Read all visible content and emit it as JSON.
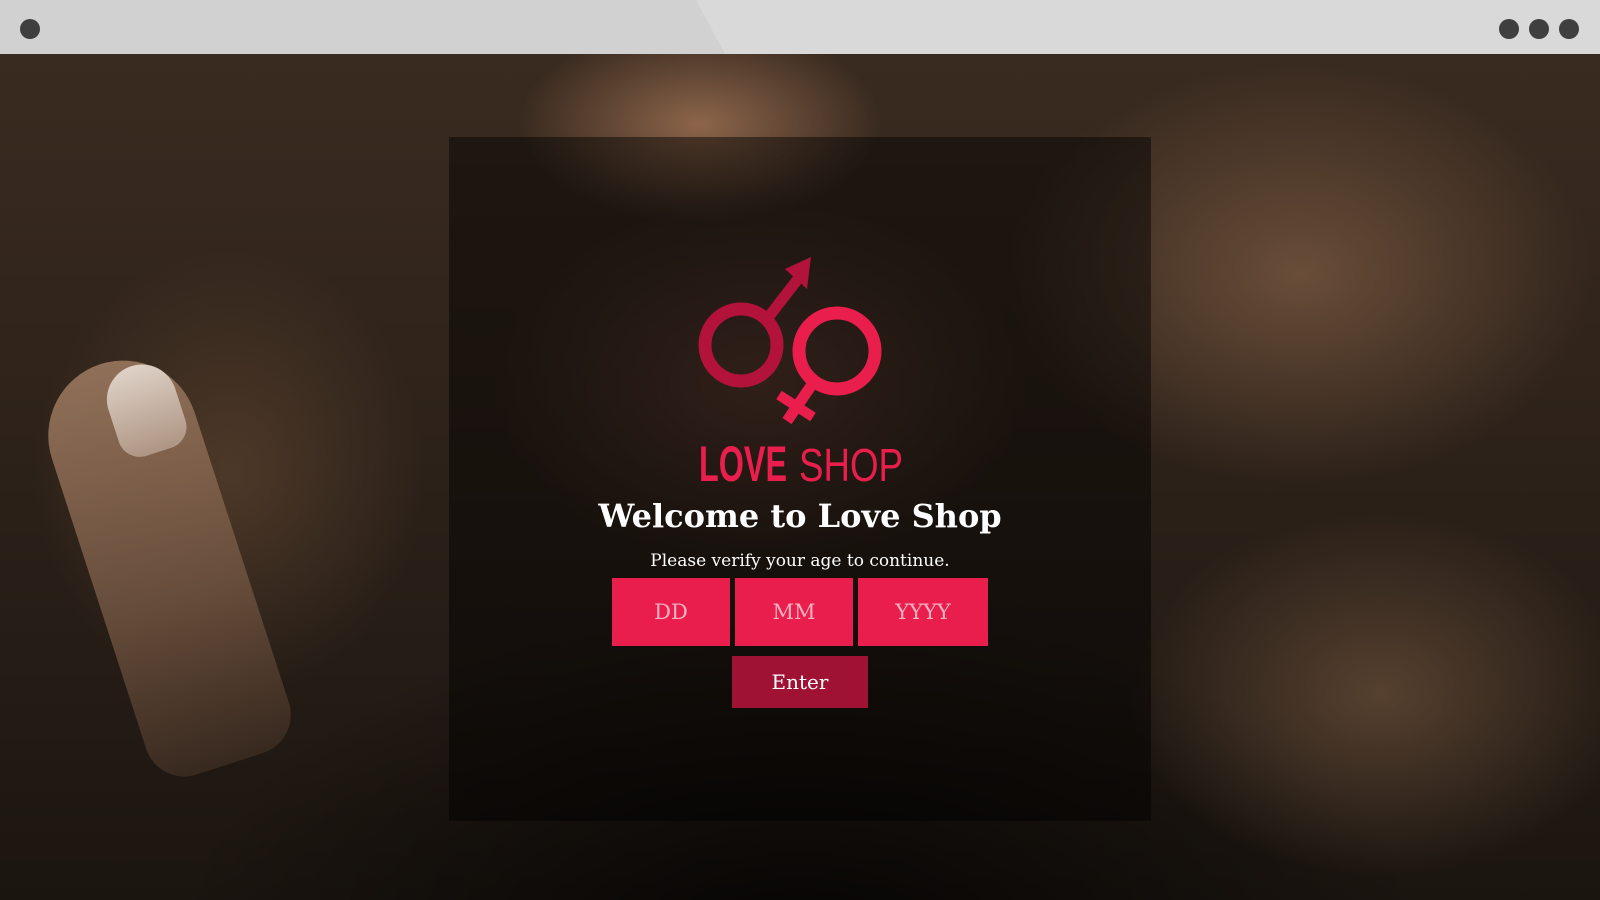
{
  "browser": {
    "window_controls": [
      "circle",
      "circle",
      "circle"
    ]
  },
  "background": {
    "description_icon": "photo-background"
  },
  "modal": {
    "logo": {
      "text_love": "LOVE",
      "text_shop": "SHOP",
      "primary_color": "#e91e4c",
      "dark_color": "#b3123a"
    },
    "title": "Welcome to Love Shop",
    "subtitle": "Please verify your age to continue.",
    "fields": {
      "day_placeholder": "DD",
      "month_placeholder": "MM",
      "year_placeholder": "YYYY"
    },
    "enter_label": "Enter"
  },
  "colors": {
    "accent": "#e91e4c",
    "button": "#a01233",
    "chrome": "#d9d9d9"
  }
}
